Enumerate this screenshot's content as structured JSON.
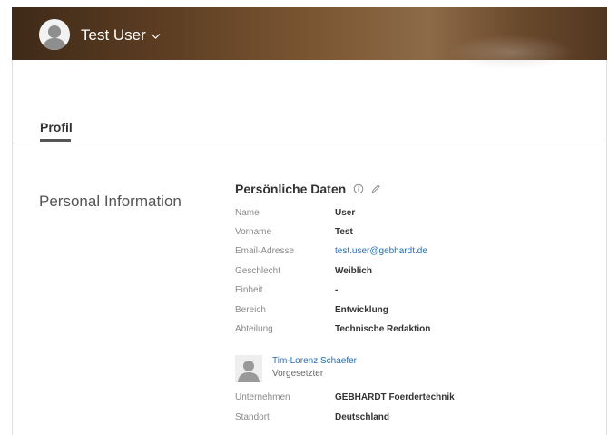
{
  "header": {
    "user_name": "Test User"
  },
  "tabs": [
    {
      "label": "Profil"
    }
  ],
  "section": {
    "title": "Personal Information"
  },
  "card": {
    "title": "Persönliche Daten",
    "fields": [
      {
        "label": "Name",
        "value": "User"
      },
      {
        "label": "Vorname",
        "value": "Test"
      },
      {
        "label": "Email-Adresse",
        "value": "test.user@gebhardt.de"
      },
      {
        "label": "Geschlecht",
        "value": "Weiblich"
      },
      {
        "label": "Einheit",
        "value": "-"
      },
      {
        "label": "Bereich",
        "value": "Entwicklung"
      },
      {
        "label": "Abteilung",
        "value": "Technische Redaktion"
      }
    ],
    "manager": {
      "name": "Tim-Lorenz Schaefer",
      "role": "Vorgesetzter"
    },
    "fields_after": [
      {
        "label": "Unternehmen",
        "value": "GEBHARDT Foerdertechnik"
      },
      {
        "label": "Standort",
        "value": "Deutschland"
      }
    ]
  },
  "colors": {
    "link": "#2a6db2",
    "header_brown": "#6b4a2c",
    "label_gray": "#8a8a8a"
  }
}
